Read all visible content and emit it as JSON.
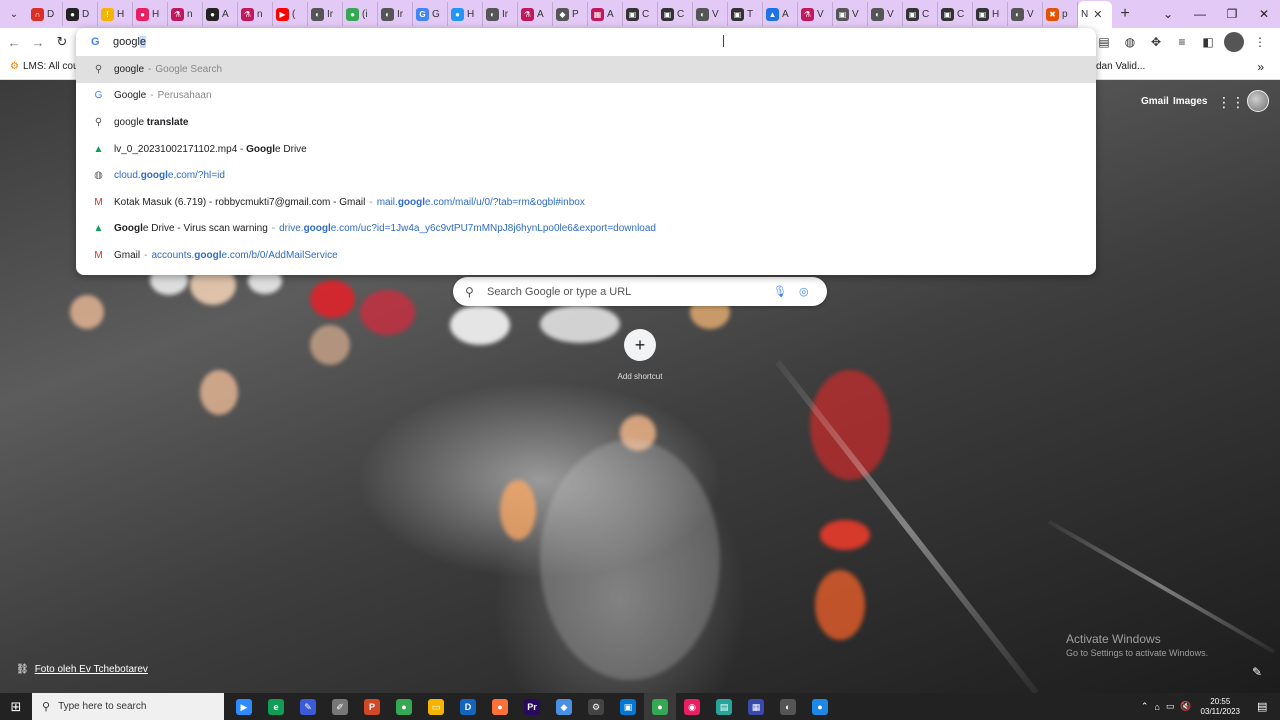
{
  "tabs": [
    {
      "label": "D",
      "color": "#d93025",
      "glyph": "∩"
    },
    {
      "label": "D",
      "color": "#222222",
      "glyph": "●"
    },
    {
      "label": "H",
      "color": "#f4b400",
      "glyph": "!"
    },
    {
      "label": "H",
      "color": "#e91e63",
      "glyph": "●"
    },
    {
      "label": "n",
      "color": "#c2185b",
      "glyph": "⚗"
    },
    {
      "label": "A",
      "color": "#222222",
      "glyph": "●"
    },
    {
      "label": "n",
      "color": "#c2185b",
      "glyph": "⚗"
    },
    {
      "label": "(",
      "color": "#ff0000",
      "glyph": "▶"
    },
    {
      "label": "Ir",
      "color": "#555555",
      "glyph": "◐"
    },
    {
      "label": "(i",
      "color": "#34a853",
      "glyph": "●"
    },
    {
      "label": "Ir",
      "color": "#555555",
      "glyph": "◐"
    },
    {
      "label": "G",
      "color": "#4285f4",
      "glyph": "G"
    },
    {
      "label": "H",
      "color": "#2196f3",
      "glyph": "●"
    },
    {
      "label": "Ir",
      "color": "#555555",
      "glyph": "◐"
    },
    {
      "label": "A",
      "color": "#c2185b",
      "glyph": "⚗"
    },
    {
      "label": "P",
      "color": "#555555",
      "glyph": "◆"
    },
    {
      "label": "A",
      "color": "#c2185b",
      "glyph": "▦"
    },
    {
      "label": "C",
      "color": "#333333",
      "glyph": "▣"
    },
    {
      "label": "C",
      "color": "#333333",
      "glyph": "▣"
    },
    {
      "label": "V",
      "color": "#555555",
      "glyph": "◐"
    },
    {
      "label": "T",
      "color": "#333333",
      "glyph": "▣"
    },
    {
      "label": "A",
      "color": "#1a73e8",
      "glyph": "▲"
    },
    {
      "label": "V",
      "color": "#c2185b",
      "glyph": "⚗"
    },
    {
      "label": "V",
      "color": "#555555",
      "glyph": "▣"
    },
    {
      "label": "V",
      "color": "#555555",
      "glyph": "◐"
    },
    {
      "label": "C",
      "color": "#333333",
      "glyph": "▣"
    },
    {
      "label": "C",
      "color": "#333333",
      "glyph": "▣"
    },
    {
      "label": "H",
      "color": "#333333",
      "glyph": "▣"
    },
    {
      "label": "V",
      "color": "#555555",
      "glyph": "◐"
    },
    {
      "label": "p",
      "color": "#e65100",
      "glyph": "✖"
    }
  ],
  "active_tab": {
    "label": "N",
    "close": "✕"
  },
  "new_tab": "+",
  "window_controls": {
    "list": "⌄",
    "minimize": "—",
    "restore": "❐",
    "close": "✕"
  },
  "toolbar": {
    "back": "←",
    "forward": "→",
    "reload": "↻"
  },
  "bookmarks": {
    "first": "LMS: All course",
    "right": "dan Valid...",
    "more": "»"
  },
  "omnibox": {
    "typed": "googl",
    "autocomplete": "e",
    "suggestions": [
      {
        "icon": "search",
        "main": "google",
        "sub": "Google Search"
      },
      {
        "icon": "google",
        "main": "Google",
        "sub": "Perusahaan"
      },
      {
        "icon": "search",
        "main_plain": "google",
        "main_bold": " translate"
      },
      {
        "icon": "drive",
        "pre": "lv_0_20231002171102.mp4 - ",
        "bold": "Googl",
        "post": "e Drive"
      },
      {
        "icon": "globe",
        "url_pre": "cloud.",
        "url_bold": "googl",
        "url_post": "e.com/?hl=id"
      },
      {
        "icon": "gmail",
        "title": "Kotak Masuk (6.719) - robbycmukti7@gmail.com - Gmail",
        "url_pre": "mail.",
        "url_bold": "googl",
        "url_post": "e.com/mail/u/0/?tab=rm&ogbl#inbox"
      },
      {
        "icon": "drive",
        "bold": "Googl",
        "title_post": "e Drive - Virus scan warning",
        "url_pre": "drive.",
        "url_bold": "googl",
        "url_post": "e.com/uc?id=1Jw4a_y6c9vtPU7mMNpJ8j6hynLpo0le6&export=download"
      },
      {
        "icon": "gmail",
        "title": "Gmail",
        "url_pre": "accounts.",
        "url_bold": "googl",
        "url_post": "e.com/b/0/AddMailService"
      }
    ]
  },
  "ntp": {
    "gmail": "Gmail",
    "images": "Images",
    "search_placeholder": "Search Google or type a URL",
    "add_shortcut": "Add shortcut",
    "photo_credit": "Foto oleh Ev Tchebotarev"
  },
  "watermark": {
    "line1": "Activate Windows",
    "line2": "Go to Settings to activate Windows."
  },
  "taskbar": {
    "search_placeholder": "Type here to search",
    "apps": [
      {
        "name": "zoom",
        "color": "#2d8cff",
        "glyph": "▶"
      },
      {
        "name": "edge",
        "color": "#0f9d58",
        "glyph": "e"
      },
      {
        "name": "paint",
        "color": "#3b5bdb",
        "glyph": "✎"
      },
      {
        "name": "pen",
        "color": "#777777",
        "glyph": "✐"
      },
      {
        "name": "powerpoint",
        "color": "#d24726",
        "glyph": "P"
      },
      {
        "name": "chrome",
        "color": "#34a853",
        "glyph": "●"
      },
      {
        "name": "explorer",
        "color": "#f4b400",
        "glyph": "▭"
      },
      {
        "name": "dict",
        "color": "#1565c0",
        "glyph": "D"
      },
      {
        "name": "firefox",
        "color": "#ff7139",
        "glyph": "●"
      },
      {
        "name": "premiere",
        "color": "#2a0a5e",
        "glyph": "Pr"
      },
      {
        "name": "cube",
        "color": "#4a90e2",
        "glyph": "◆"
      },
      {
        "name": "settings",
        "color": "#444444",
        "glyph": "⚙"
      },
      {
        "name": "monitor",
        "color": "#0078d4",
        "glyph": "▣"
      },
      {
        "name": "chrome-active",
        "color": "#34a853",
        "glyph": "●"
      },
      {
        "name": "screenrec",
        "color": "#e91e63",
        "glyph": "◉"
      },
      {
        "name": "notes",
        "color": "#26a69a",
        "glyph": "▤"
      },
      {
        "name": "network",
        "color": "#3949ab",
        "glyph": "▦"
      },
      {
        "name": "vpn",
        "color": "#555555",
        "glyph": "◐"
      },
      {
        "name": "globe",
        "color": "#1e88e5",
        "glyph": "●"
      }
    ],
    "time": "20:55",
    "date": "03/11/2023"
  }
}
